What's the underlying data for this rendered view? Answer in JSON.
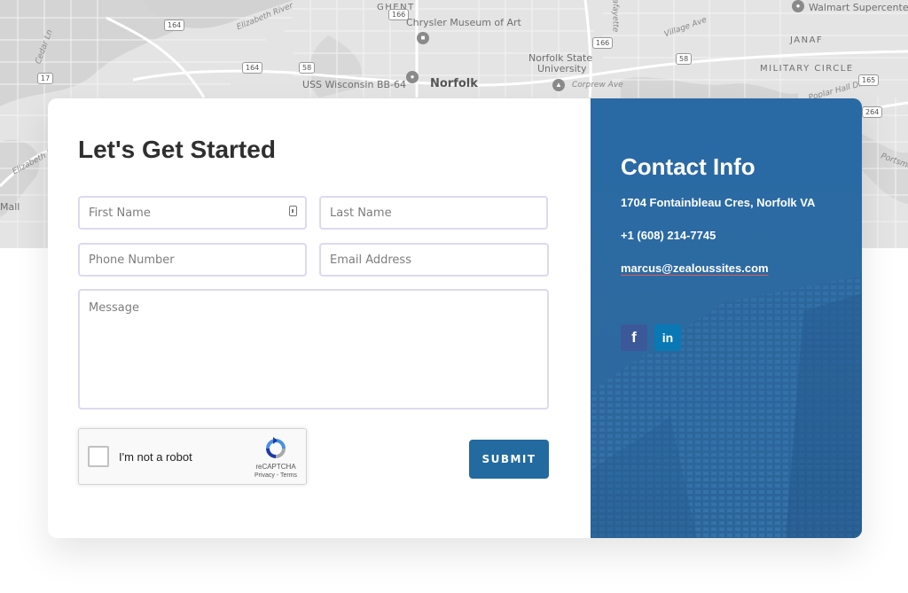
{
  "map": {
    "labels": {
      "ghent": "GHENT",
      "chrysler": "Chrysler Museum of Art",
      "elizabeth_river_1": "Elizabeth River",
      "elizabeth_river_2": "Elizabeth R",
      "norfolk_state_1": "Norfolk State",
      "norfolk_state_2": "University",
      "uss_wisconsin": "USS Wisconsin BB-64",
      "norfolk": "Norfolk",
      "walmart": "Walmart Supercenter",
      "janaf": "JANAF",
      "military_circle": "MILITARY CIRCLE",
      "mall": "Mall",
      "corprew_ave": "Corprew Ave",
      "village_ave": "Village Ave",
      "popular_hall": "Poplar Hall Dr",
      "cedar_ln": "Cedar Ln",
      "lafayette": "Lafayette",
      "portsmouth": "Portsmouth"
    },
    "shields": [
      "164",
      "17",
      "164",
      "58",
      "166",
      "58",
      "165",
      "264",
      "166"
    ]
  },
  "form": {
    "title": "Let's Get Started",
    "first_name_placeholder": "First Name",
    "last_name_placeholder": "Last Name",
    "phone_placeholder": "Phone Number",
    "email_placeholder": "Email Address",
    "message_placeholder": "Message",
    "recaptcha_label": "I'm not a robot",
    "recaptcha_brand": "reCAPTCHA",
    "recaptcha_links": "Privacy - Terms",
    "submit_label": "SUBMIT"
  },
  "contact": {
    "title": "Contact Info",
    "address": "1704 Fontainbleau Cres, Norfolk VA",
    "phone": "+1 (608) 214-7745",
    "email": "marcus@zealoussites.com",
    "social": [
      {
        "name": "facebook",
        "icon": "facebook-icon",
        "glyph": "f",
        "color": "#3b5998"
      },
      {
        "name": "linkedin",
        "icon": "linkedin-icon",
        "glyph": "in",
        "color": "#0a78b4"
      }
    ]
  },
  "colors": {
    "accent": "#236aa0",
    "contact_panel": "#2d6aa0",
    "field_border": "#dcdaf0",
    "map_bg": "#e4e4e4"
  }
}
